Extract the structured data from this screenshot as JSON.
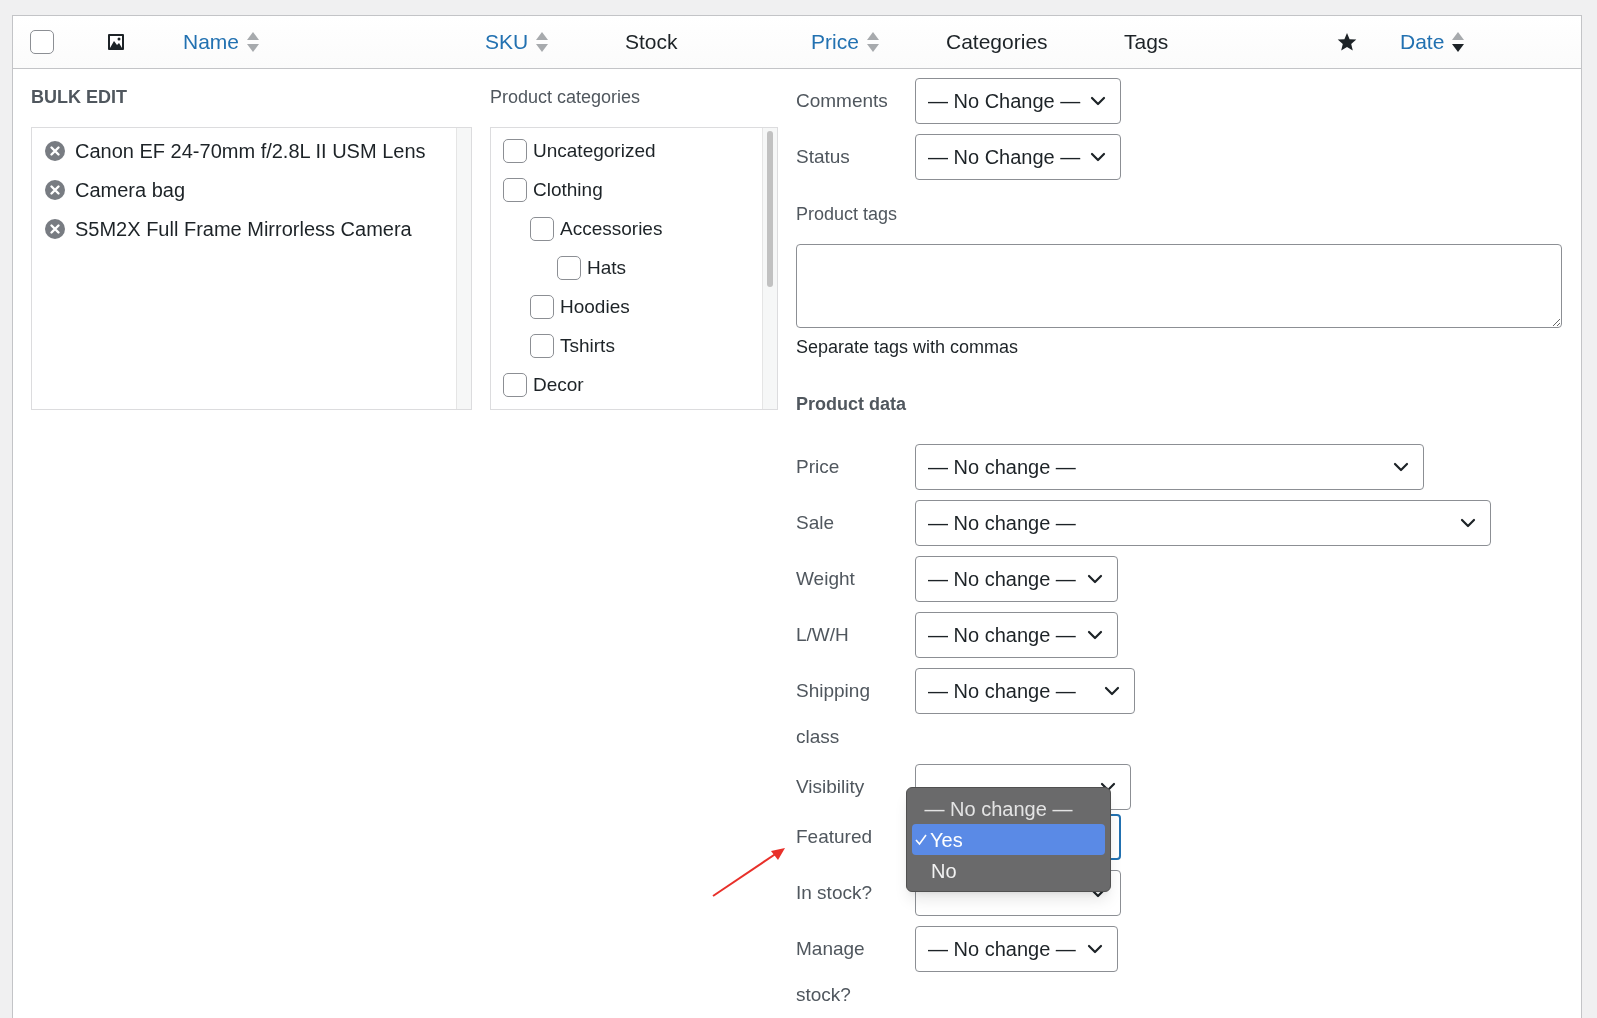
{
  "header": {
    "columns": [
      {
        "kind": "checkbox",
        "checked": false
      },
      {
        "kind": "image"
      },
      {
        "kind": "sortable",
        "label": "Name",
        "sorted_desc": false
      },
      {
        "kind": "sortable",
        "label": "SKU",
        "sorted_desc": false
      },
      {
        "kind": "plain",
        "label": "Stock"
      },
      {
        "kind": "sortable",
        "label": "Price",
        "sorted_desc": false
      },
      {
        "kind": "plain",
        "label": "Categories"
      },
      {
        "kind": "plain",
        "label": "Tags"
      },
      {
        "kind": "star"
      },
      {
        "kind": "sortable",
        "label": "Date",
        "sorted_desc": true
      }
    ]
  },
  "bulk_edit": {
    "title": "BULK EDIT",
    "products": [
      "Canon EF 24-70mm f/2.8L II USM Lens",
      "Camera bag",
      "S5M2X Full Frame Mirrorless Camera"
    ]
  },
  "categories": {
    "title": "Product categories",
    "items": [
      {
        "label": "Uncategorized",
        "checked": false
      },
      {
        "label": "Clothing",
        "checked": false,
        "children": [
          {
            "label": "Accessories",
            "checked": false,
            "children": [
              {
                "label": "Hats",
                "checked": false
              }
            ]
          },
          {
            "label": "Hoodies",
            "checked": false
          },
          {
            "label": "Tshirts",
            "checked": false
          }
        ]
      },
      {
        "label": "Decor",
        "checked": false
      }
    ]
  },
  "fields": [
    {
      "label": "Comments",
      "value": "— No Change —"
    },
    {
      "label": "Status",
      "value": "— No Change —"
    }
  ],
  "product_tags": {
    "label": "Product tags",
    "hint": "Separate tags with commas"
  },
  "product_data": {
    "title": "Product data",
    "fields": [
      {
        "label": "Price",
        "value": "— No change —"
      },
      {
        "label": "Sale",
        "value": "— No change —"
      },
      {
        "label": "Weight",
        "value": "— No change —"
      },
      {
        "label": "L/W/H",
        "value": "— No change —"
      },
      {
        "label": "Shipping class",
        "value": "— No change —"
      },
      {
        "label": "Visibility"
      },
      {
        "label": "Featured",
        "focused": true,
        "options": [
          {
            "label": "— No change —",
            "selected": false
          },
          {
            "label": "Yes",
            "selected": true
          },
          {
            "label": "No",
            "selected": false
          }
        ]
      },
      {
        "label": "In stock?"
      },
      {
        "label": "Manage stock?",
        "value": "— No change —"
      }
    ]
  }
}
